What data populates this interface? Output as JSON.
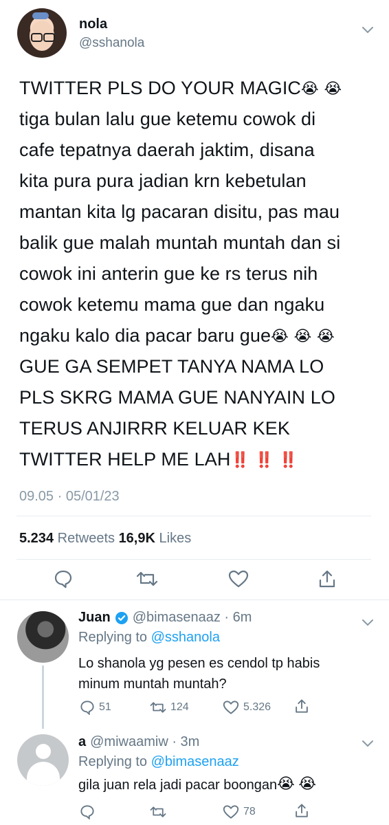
{
  "tweet": {
    "author_name": "nola",
    "author_handle": "@sshanola",
    "lines": [
      "TWITTER PLS DO YOUR MAGIC",
      "tiga bulan lalu gue ketemu cowok di",
      "cafe tepatnya daerah jaktim, disana",
      "kita pura pura jadian krn kebetulan",
      "mantan kita lg pacaran disitu, pas mau",
      "balik gue malah muntah muntah dan si",
      "cowok ini anterin gue ke rs terus nih",
      "cowok ketemu mama gue dan ngaku",
      "ngaku kalo dia pacar baru gue",
      "GUE GA SEMPET TANYA NAMA LO",
      "PLS SKRG MAMA GUE NANYAIN LO",
      "TERUS ANJIRRR KELUAR KEK",
      "TWITTER HELP ME LAH"
    ],
    "emoji_cry": "😭",
    "emoji_bang": "‼️",
    "timestamp": "09.05 · 05/01/23",
    "retweets_count": "5.234",
    "retweets_label": "Retweets",
    "likes_count": "16,9K",
    "likes_label": "Likes"
  },
  "replies": [
    {
      "name": "Juan",
      "handle_time": "@bimasenaaz · 6m",
      "replying_prefix": "Replying to",
      "replying_to": "@sshanola",
      "text_lines": [
        "Lo shanola yg pesen es cendol tp habis",
        "minum muntah muntah?"
      ],
      "reply_count": "51",
      "retweet_count": "124",
      "like_count": "5.326",
      "verified": true
    },
    {
      "name": "a",
      "handle_time": "@miwaamiw · 3m",
      "replying_prefix": "Replying to",
      "replying_to": "@bimasenaaz",
      "text": "gila juan rela jadi pacar boongan",
      "like_count": "78"
    }
  ],
  "colors": {
    "accent": "#1da1f2",
    "muted": "#657786",
    "separator": "#e6ecf0"
  }
}
